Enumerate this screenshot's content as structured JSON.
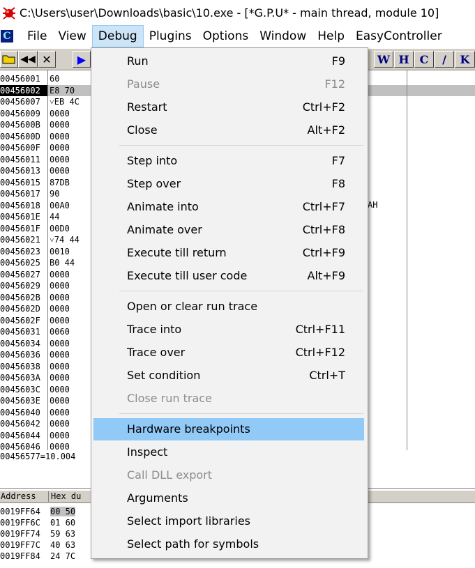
{
  "window": {
    "title": "C:\\Users\\user\\Downloads\\basic\\10.exe - [*G.P.U* - main thread, module 10]"
  },
  "menubar": {
    "logo_letter": "C",
    "items": [
      "File",
      "View",
      "Debug",
      "Plugins",
      "Options",
      "Window",
      "Help",
      "EasyController"
    ]
  },
  "toolbar": {
    "right_buttons": [
      "W",
      "H",
      "C",
      "/",
      "K"
    ]
  },
  "cpu_lines": [
    {
      "addr": "00456001",
      "bytes": "60"
    },
    {
      "addr": "00456002",
      "bytes": "E8 70"
    },
    {
      "addr": "00456007",
      "bytes": "˅EB 4C"
    },
    {
      "addr": "00456009",
      "bytes": "0000"
    },
    {
      "addr": "0045600B",
      "bytes": "0000"
    },
    {
      "addr": "0045600D",
      "bytes": "0000"
    },
    {
      "addr": "0045600F",
      "bytes": "0000"
    },
    {
      "addr": "00456011",
      "bytes": "0000"
    },
    {
      "addr": "00456013",
      "bytes": "0000"
    },
    {
      "addr": "00456015",
      "bytes": "87DB"
    },
    {
      "addr": "00456017",
      "bytes": "90"
    },
    {
      "addr": "00456018",
      "bytes": "00A0"
    },
    {
      "addr": "0045601E",
      "bytes": "44"
    },
    {
      "addr": "0045601F",
      "bytes": "00D0"
    },
    {
      "addr": "00456021",
      "bytes": "˅74 44"
    },
    {
      "addr": "00456023",
      "bytes": "0010"
    },
    {
      "addr": "00456025",
      "bytes": "B0 44"
    },
    {
      "addr": "00456027",
      "bytes": "0000"
    },
    {
      "addr": "00456029",
      "bytes": "0000"
    },
    {
      "addr": "0045602B",
      "bytes": "0000"
    },
    {
      "addr": "0045602D",
      "bytes": "0000"
    },
    {
      "addr": "0045602F",
      "bytes": "0000"
    },
    {
      "addr": "00456031",
      "bytes": "0060"
    },
    {
      "addr": "00456034",
      "bytes": "0000"
    },
    {
      "addr": "00456036",
      "bytes": "0000"
    },
    {
      "addr": "00456038",
      "bytes": "0000"
    },
    {
      "addr": "0045603A",
      "bytes": "0000"
    },
    {
      "addr": "0045603C",
      "bytes": "0000"
    },
    {
      "addr": "0045603E",
      "bytes": "0000"
    },
    {
      "addr": "00456040",
      "bytes": "0000"
    },
    {
      "addr": "00456042",
      "bytes": "0000"
    },
    {
      "addr": "00456044",
      "bytes": "0000"
    },
    {
      "addr": "00456046",
      "bytes": "0000"
    }
  ],
  "cpu_comment": "AH",
  "info_line": "00456577=10.004",
  "dump": {
    "headers": [
      "Address",
      "Hex du"
    ],
    "rows": [
      {
        "addr": "0019FF64",
        "hex": "00 50"
      },
      {
        "addr": "0019FF6C",
        "hex": "01 60"
      },
      {
        "addr": "0019FF74",
        "hex": "59 63"
      },
      {
        "addr": "0019FF7C",
        "hex": "40 63"
      },
      {
        "addr": "0019FF84",
        "hex": "24 7C"
      }
    ]
  },
  "debug_menu": {
    "items": [
      {
        "label": "Run",
        "shortcut": "F9",
        "enabled": true
      },
      {
        "label": "Pause",
        "shortcut": "F12",
        "enabled": false
      },
      {
        "label": "Restart",
        "shortcut": "Ctrl+F2",
        "enabled": true
      },
      {
        "label": "Close",
        "shortcut": "Alt+F2",
        "enabled": true
      },
      {
        "label": "Step into",
        "shortcut": "F7",
        "enabled": true
      },
      {
        "label": "Step over",
        "shortcut": "F8",
        "enabled": true
      },
      {
        "label": "Animate into",
        "shortcut": "Ctrl+F7",
        "enabled": true
      },
      {
        "label": "Animate over",
        "shortcut": "Ctrl+F8",
        "enabled": true
      },
      {
        "label": "Execute till return",
        "shortcut": "Ctrl+F9",
        "enabled": true
      },
      {
        "label": "Execute till user code",
        "shortcut": "Alt+F9",
        "enabled": true
      },
      {
        "label": "Open or clear run trace",
        "shortcut": "",
        "enabled": true
      },
      {
        "label": "Trace into",
        "shortcut": "Ctrl+F11",
        "enabled": true
      },
      {
        "label": "Trace over",
        "shortcut": "Ctrl+F12",
        "enabled": true
      },
      {
        "label": "Set condition",
        "shortcut": "Ctrl+T",
        "enabled": true
      },
      {
        "label": "Close run trace",
        "shortcut": "",
        "enabled": false
      },
      {
        "label": "Hardware breakpoints",
        "shortcut": "",
        "enabled": true,
        "highlighted": true
      },
      {
        "label": "Inspect",
        "shortcut": "",
        "enabled": true
      },
      {
        "label": "Call DLL export",
        "shortcut": "",
        "enabled": false
      },
      {
        "label": "Arguments",
        "shortcut": "",
        "enabled": true
      },
      {
        "label": "Select import libraries",
        "shortcut": "",
        "enabled": true
      },
      {
        "label": "Select path for symbols",
        "shortcut": "",
        "enabled": true
      }
    ]
  },
  "colors": {
    "highlight": "#91c9f7",
    "menubar_active": "#cce4f7",
    "toolbar_bg": "#d4d0c8",
    "disabled_text": "#8c8c8c"
  }
}
